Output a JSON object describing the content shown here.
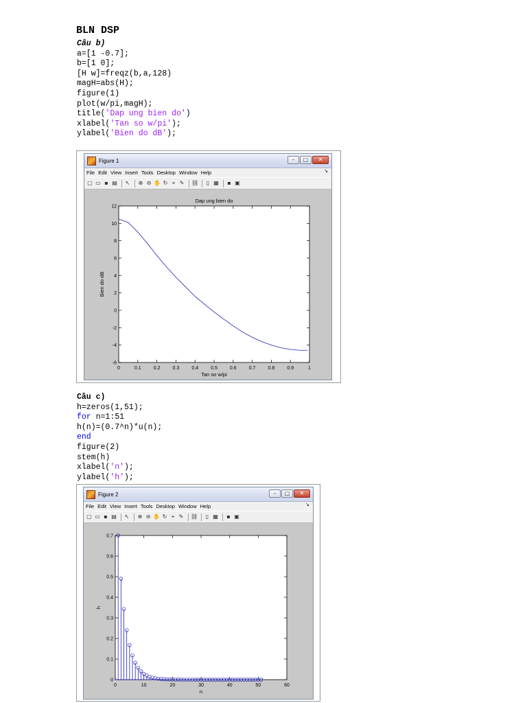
{
  "document": {
    "title": "BLN DSP",
    "section_b": {
      "heading": "Câu b)",
      "code_lines": [
        [
          {
            "t": "a=[1 -0.7];"
          }
        ],
        [
          {
            "t": "b=[1 0];"
          }
        ],
        [
          {
            "t": "[H w]=freqz(b,a,128)"
          }
        ],
        [
          {
            "t": "magH=abs(H);"
          }
        ],
        [
          {
            "t": "figure(1)"
          }
        ],
        [
          {
            "t": "plot(w/pi,magH);"
          }
        ],
        [
          {
            "t": "title("
          },
          {
            "t": "'Dap ung bien do'",
            "c": "str"
          },
          {
            "t": ")"
          }
        ],
        [
          {
            "t": "xlabel("
          },
          {
            "t": "'Tan so w/pi'",
            "c": "str"
          },
          {
            "t": ");"
          }
        ],
        [
          {
            "t": "ylabel("
          },
          {
            "t": "'Bien do dB'",
            "c": "str"
          },
          {
            "t": ");"
          }
        ]
      ]
    },
    "section_c": {
      "heading": "Câu c)",
      "code_lines": [
        [
          {
            "t": "h=zeros(1,51);"
          }
        ],
        [
          {
            "t": "for",
            "c": "kw"
          },
          {
            "t": " n=1:51"
          }
        ],
        [
          {
            "t": "h(n)=(0.7^n)*u(n);"
          }
        ],
        [
          {
            "t": "end",
            "c": "kw"
          }
        ],
        [
          {
            "t": "figure(2)"
          }
        ],
        [
          {
            "t": "stem(h)"
          }
        ],
        [
          {
            "t": "xlabel("
          },
          {
            "t": "'n'",
            "c": "str"
          },
          {
            "t": ");"
          }
        ],
        [
          {
            "t": "ylabel("
          },
          {
            "t": "'h'",
            "c": "str"
          },
          {
            "t": ");"
          }
        ]
      ]
    }
  },
  "window_common": {
    "menu_items": [
      "File",
      "Edit",
      "View",
      "Insert",
      "Tools",
      "Desktop",
      "Window",
      "Help"
    ],
    "menu_arrow": "↘",
    "toolbar_icons": [
      "new-figure-icon",
      "open-file-icon",
      "save-icon",
      "print-icon",
      "|",
      "pointer-icon",
      "|",
      "zoom-in-icon",
      "zoom-out-icon",
      "pan-icon",
      "rotate-icon",
      "data-cursor-icon",
      "brush-icon",
      "|",
      "link-plot-icon",
      "|",
      "colorbar-icon",
      "legend-icon",
      "|",
      "hide-plot-tools-icon",
      "show-plot-tools-icon"
    ],
    "toolbar_glyphs": {
      "new-figure-icon": "▢",
      "open-file-icon": "▭",
      "save-icon": "▪",
      "print-icon": "▤",
      "pointer-icon": "↖",
      "zoom-in-icon": "⊕",
      "zoom-out-icon": "⊖",
      "pan-icon": "✋",
      "rotate-icon": "↻",
      "data-cursor-icon": "⌖",
      "brush-icon": "✎",
      "link-plot-icon": "⛓",
      "colorbar-icon": "▯",
      "legend-icon": "▦",
      "hide-plot-tools-icon": "▪",
      "show-plot-tools-icon": "▣"
    },
    "window_buttons": {
      "minimize": "–",
      "maximize": "□",
      "close": "✕"
    },
    "line_color": "#1f1fb4",
    "title_gradient_accent": "#d6dcef"
  },
  "figures": [
    {
      "window_title": "Figure 1",
      "chart_data": {
        "type": "line",
        "title": "Dap ung bien do",
        "xlabel": "Tan so w/pi",
        "ylabel": "Bien do dB",
        "xlim": [
          0,
          1
        ],
        "ylim": [
          -6,
          12
        ],
        "xticks": [
          0,
          0.1,
          0.2,
          0.3,
          0.4,
          0.5,
          0.6,
          0.7,
          0.8,
          0.9,
          1
        ],
        "yticks": [
          -6,
          -4,
          -2,
          0,
          2,
          4,
          6,
          8,
          10,
          12
        ],
        "series": [
          {
            "x": [
              0,
              0.05,
              0.1,
              0.15,
              0.2,
              0.25,
              0.3,
              0.35,
              0.4,
              0.45,
              0.5,
              0.55,
              0.6,
              0.65,
              0.7,
              0.75,
              0.8,
              0.85,
              0.9,
              0.95,
              0.99
            ],
            "values": [
              10.5,
              10.1,
              9.0,
              7.7,
              6.3,
              5.0,
              3.8,
              2.7,
              1.6,
              0.7,
              -0.2,
              -1.0,
              -1.8,
              -2.5,
              -3.1,
              -3.6,
              -4.0,
              -4.3,
              -4.5,
              -4.6,
              -4.6
            ]
          }
        ],
        "color": "#1f1fb4",
        "grid": false
      }
    },
    {
      "window_title": "Figure 2",
      "chart_data": {
        "type": "stem",
        "title": "",
        "xlabel": "n",
        "ylabel": "h",
        "xlim": [
          0,
          60
        ],
        "ylim": [
          0,
          0.7
        ],
        "xticks": [
          0,
          10,
          20,
          30,
          40,
          50,
          60
        ],
        "yticks": [
          0,
          0.1,
          0.2,
          0.3,
          0.4,
          0.5,
          0.6,
          0.7
        ],
        "x_start": 1,
        "values": [
          0.7,
          0.49,
          0.343,
          0.2401,
          0.168,
          0.1176,
          0.0824,
          0.0576,
          0.0404,
          0.0282,
          0.0198,
          0.0138,
          0.0097,
          0.0068,
          0.0047,
          0.0033,
          0.0023,
          0.0016,
          0.0011,
          0.0008,
          0.0006,
          0.0004,
          0.0003,
          0.0002,
          0.0001,
          0.0001,
          0.0001,
          0,
          0,
          0,
          0,
          0,
          0,
          0,
          0,
          0,
          0,
          0,
          0,
          0,
          0,
          0,
          0,
          0,
          0,
          0,
          0,
          0,
          0,
          0,
          0
        ],
        "color": "#1f1fb4",
        "grid": false
      }
    }
  ]
}
